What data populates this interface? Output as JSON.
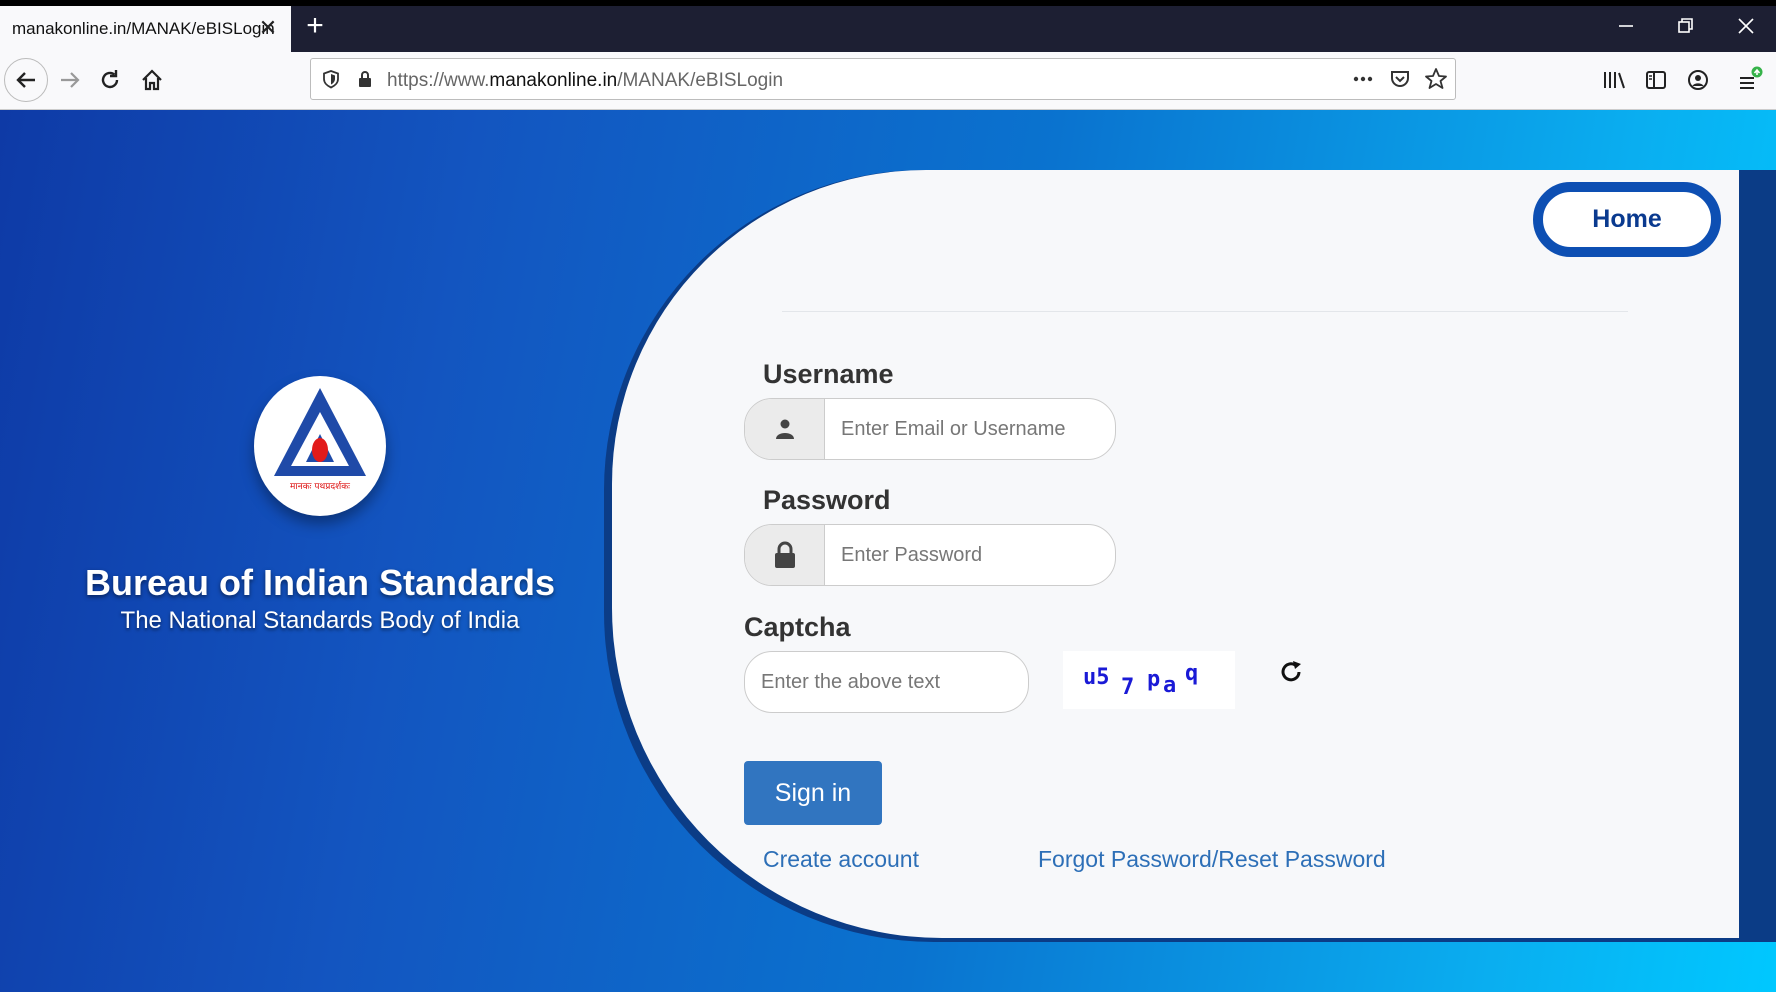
{
  "browser": {
    "tab_title": "manakonline.in/MANAK/eBISLogin",
    "url_prefix": "https://www.",
    "url_domain": "manakonline.in",
    "url_path": "/MANAK/eBISLogin"
  },
  "brand": {
    "title": "Bureau of Indian Standards",
    "subtitle": "The National Standards Body of India",
    "logo_text": "मानकः पथप्रदर्शकः"
  },
  "nav": {
    "home_label": "Home"
  },
  "form": {
    "username_label": "Username",
    "username_placeholder": "Enter Email or Username",
    "password_label": "Password",
    "password_placeholder": "Enter Password",
    "captcha_label": "Captcha",
    "captcha_placeholder": "Enter the above text",
    "captcha_chars": [
      "u5",
      "7",
      "p",
      "a",
      "q"
    ],
    "signin_label": "Sign in"
  },
  "links": {
    "create_account": "Create account",
    "forgot_password": "Forgot Password/Reset Password"
  },
  "colors": {
    "panel_bg": "#f7f8fa",
    "button_blue": "#3175c0",
    "link_blue": "#2d6fb7",
    "home_border": "#0d4fb3"
  }
}
